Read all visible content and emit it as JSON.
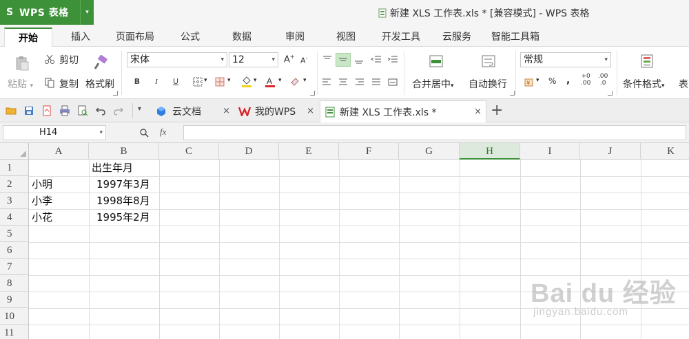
{
  "app": {
    "logo_glyph": "S",
    "name": "WPS 表格",
    "menu_caret": "▾",
    "window_title": "新建 XLS 工作表.xls * [兼容模式] - WPS 表格"
  },
  "menu": {
    "tabs": [
      "开始",
      "插入",
      "页面布局",
      "公式",
      "数据",
      "审阅",
      "视图",
      "开发工具",
      "云服务",
      "智能工具箱"
    ],
    "active_index": 0
  },
  "ribbon": {
    "paste": "粘贴",
    "cut": "剪切",
    "copy": "复制",
    "format_painter": "格式刷",
    "font_name": "宋体",
    "font_size": "12",
    "grow_font": "A",
    "shrink_font": "A",
    "bold": "B",
    "italic": "I",
    "underline": "U",
    "merge_center": "合并居中",
    "wrap_text": "自动换行",
    "number_format": "常规",
    "percent": "%",
    "comma": ",",
    "inc_decimal": ".00",
    "dec_decimal": ".0",
    "conditional_format": "条件格式",
    "table_style_partial": "表",
    "accent_green": "#3d9138",
    "font_color": "#d9262c",
    "fill_color": "#f4d01c"
  },
  "doc_tabs": [
    {
      "label": "云文档",
      "close": "×"
    },
    {
      "label": "我的WPS",
      "close": "×"
    },
    {
      "label": "新建 XLS 工作表.xls *",
      "close": "×"
    }
  ],
  "doc_tab_add": "+",
  "formula_bar": {
    "cell_ref": "H14",
    "zoom_glyph": "🔍",
    "fx": "fx"
  },
  "sheet": {
    "columns": [
      "A",
      "B",
      "C",
      "D",
      "E",
      "F",
      "G",
      "H",
      "I",
      "J",
      "K"
    ],
    "selected_column": "H",
    "rows": [
      "1",
      "2",
      "3",
      "4",
      "5",
      "6",
      "7",
      "8",
      "9",
      "10",
      "11"
    ],
    "cells": {
      "B1": "出生年月",
      "A2": "小明",
      "B2": "1997年3月",
      "A3": "小李",
      "B3": "1998年8月",
      "A4": "小花",
      "B4": "1995年2月"
    }
  },
  "watermark": {
    "main": "Bai du 经验",
    "sub": "jingyan.baidu.com"
  }
}
